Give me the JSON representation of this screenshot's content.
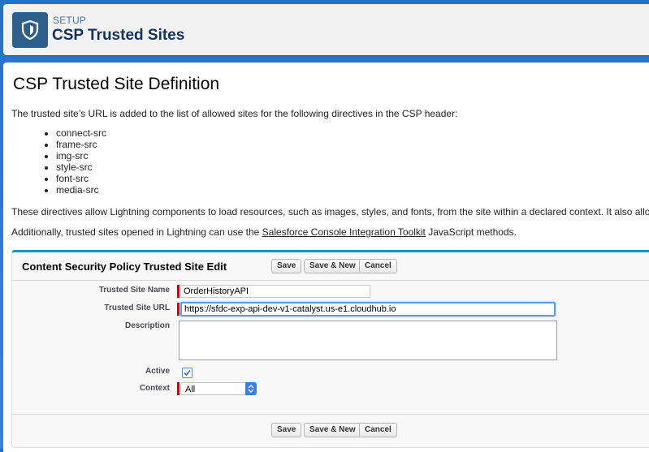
{
  "header": {
    "setup_label": "SETUP",
    "title": "CSP Trusted Sites",
    "icon": "shield-icon"
  },
  "definition": {
    "title": "CSP Trusted Site Definition",
    "intro": "The trusted site’s URL is added to the list of allowed sites for the following directives in the CSP header:",
    "directives": [
      "connect-src",
      "frame-src",
      "img-src",
      "style-src",
      "font-src",
      "media-src"
    ],
    "para2": "These directives allow Lightning components to load resources, such as images, styles, and fonts, from the site within a declared context. It also allows clie",
    "para3_before": "Additionally, trusted sites opened in Lightning can use the ",
    "para3_link": "Salesforce Console Integration Toolkit",
    "para3_after": " JavaScript methods."
  },
  "edit_panel": {
    "title": "Content Security Policy Trusted Site Edit",
    "buttons": {
      "save": "Save",
      "save_new": "Save & New",
      "cancel": "Cancel"
    },
    "fields": {
      "name_label": "Trusted Site Name",
      "name_value": "OrderHistoryAPI",
      "url_label": "Trusted Site URL",
      "url_value": "https://sfdc-exp-api-dev-v1-catalyst.us-e1.cloudhub.io",
      "description_label": "Description",
      "description_value": "",
      "active_label": "Active",
      "active_checked": true,
      "context_label": "Context",
      "context_value": "All"
    }
  },
  "colors": {
    "background": "#2573c9",
    "icon_bg": "#2e5e8a",
    "title": "#16325c",
    "panel_accent": "#1797c0",
    "required": "#cc0000"
  }
}
